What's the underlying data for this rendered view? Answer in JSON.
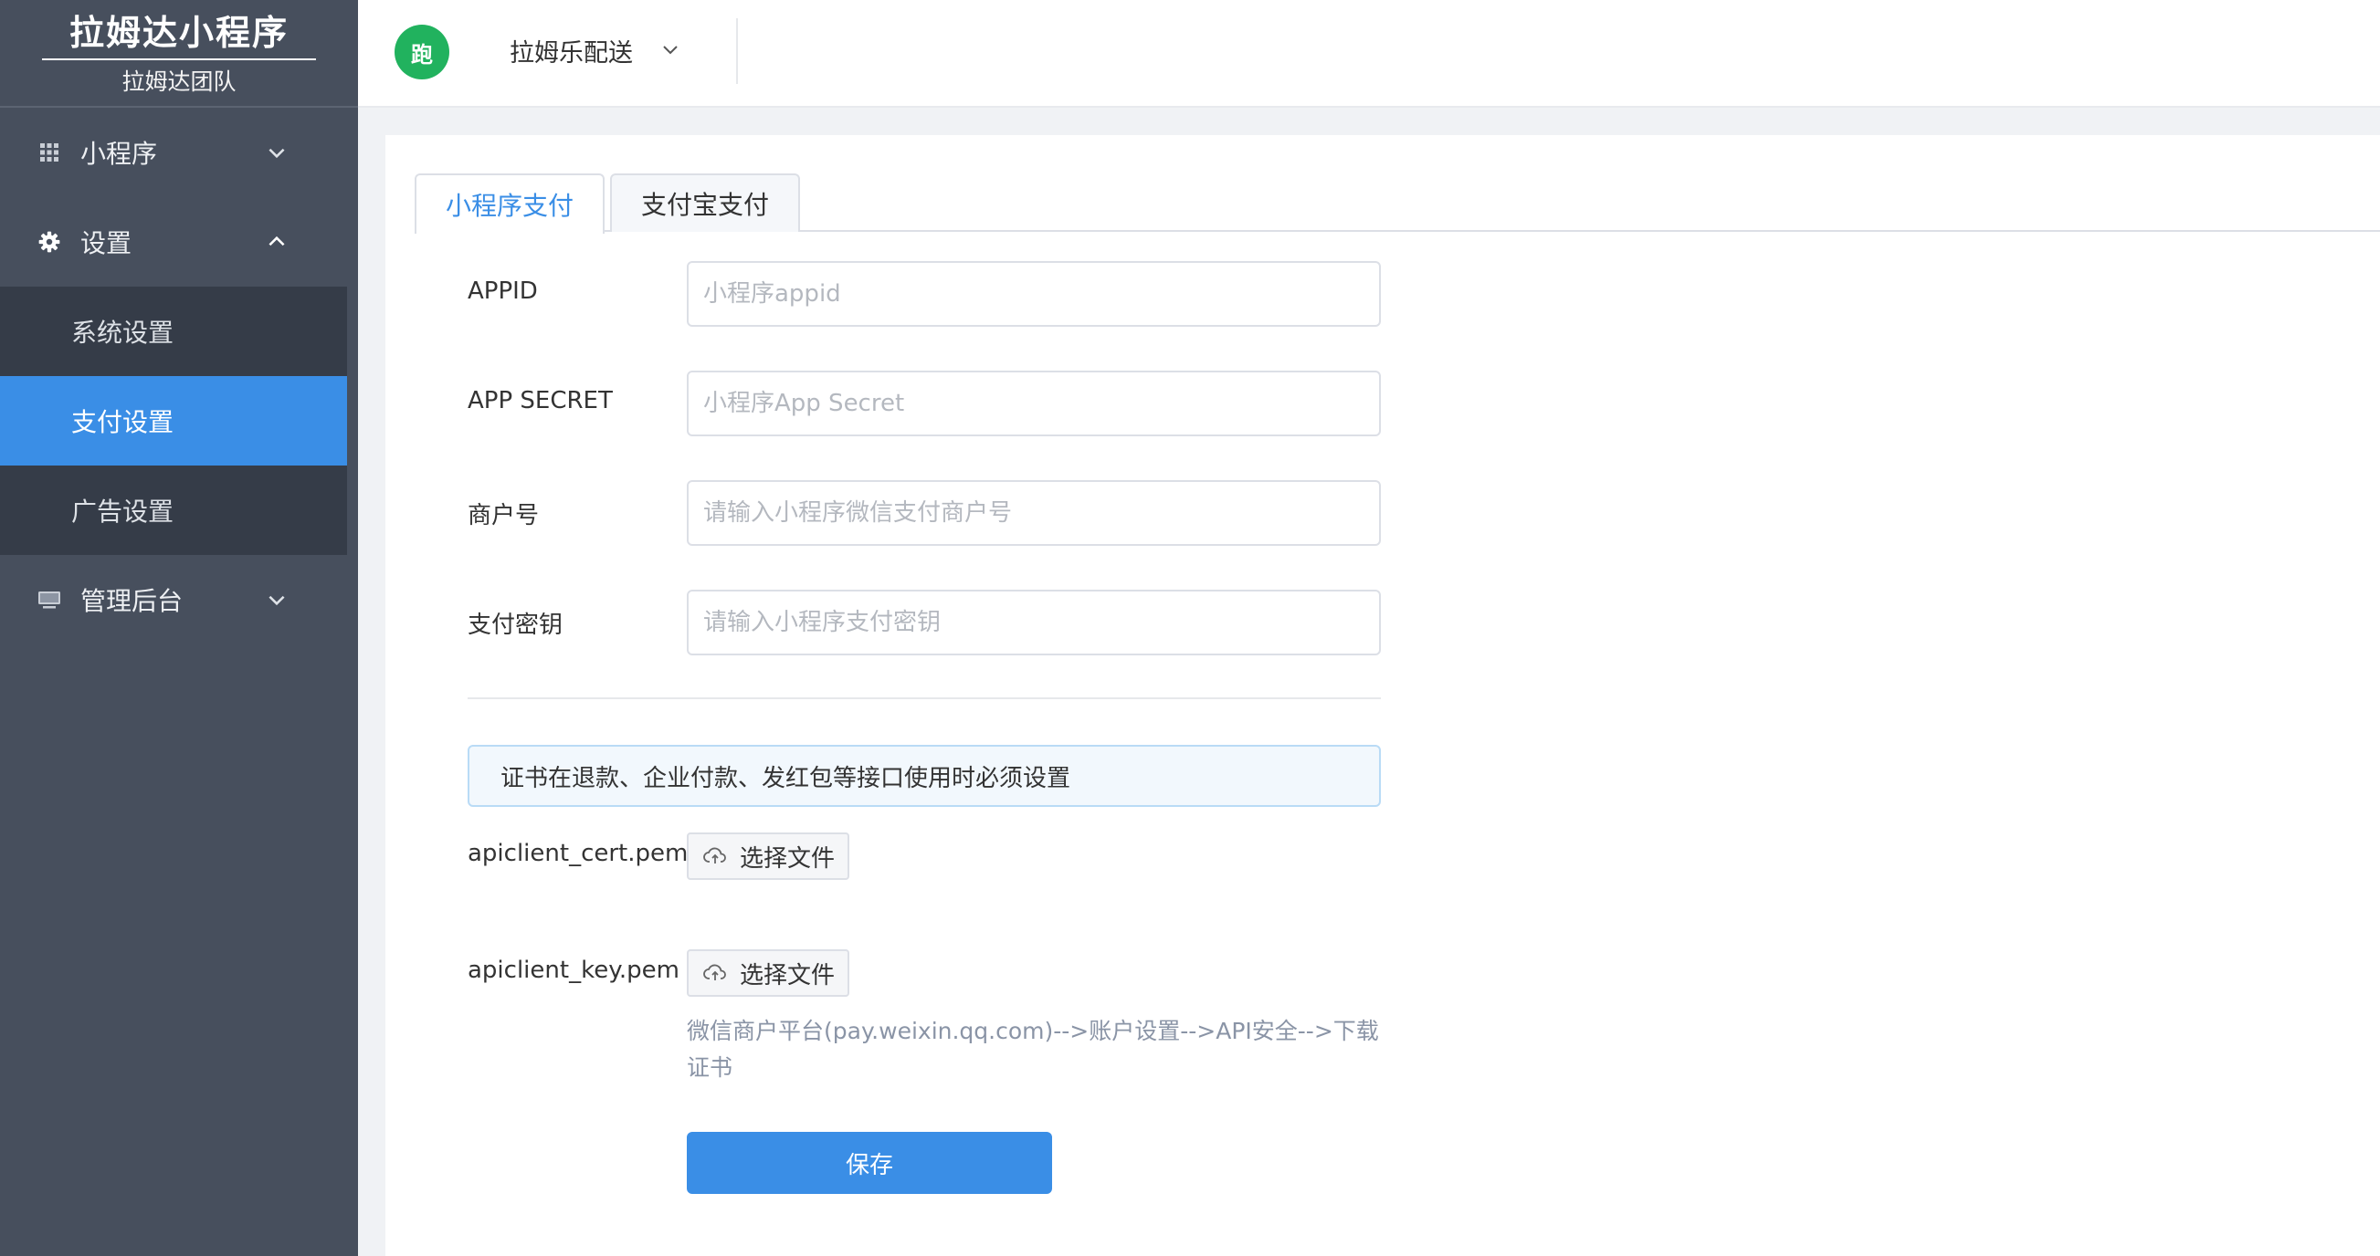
{
  "brand": {
    "title": "拉姆达小程序",
    "subtitle": "拉姆达团队"
  },
  "sidebar": {
    "menu": [
      {
        "label": "小程序",
        "icon": "grid-icon",
        "expanded": false
      },
      {
        "label": "设置",
        "icon": "gear-icon",
        "expanded": true
      },
      {
        "label": "管理后台",
        "icon": "monitor-icon",
        "expanded": false
      }
    ],
    "settings_sub": [
      {
        "label": "系统设置",
        "active": false
      },
      {
        "label": "支付设置",
        "active": true
      },
      {
        "label": "广告设置",
        "active": false
      }
    ]
  },
  "header": {
    "avatar_text": "跑",
    "store_name": "拉姆乐配送"
  },
  "tabs": [
    {
      "label": "小程序支付",
      "active": true
    },
    {
      "label": "支付宝支付",
      "active": false
    }
  ],
  "form": {
    "appid": {
      "label": "APPID",
      "placeholder": "小程序appid",
      "value": ""
    },
    "secret": {
      "label": "APP SECRET",
      "placeholder": "小程序App Secret",
      "value": ""
    },
    "mch_id": {
      "label": "商户号",
      "placeholder": "请输入小程序微信支付商户号",
      "value": ""
    },
    "pay_key": {
      "label": "支付密钥",
      "placeholder": "请输入小程序支付密钥",
      "value": ""
    },
    "notice": "证书在退款、企业付款、发红包等接口使用时必须设置",
    "cert": {
      "label": "apiclient_cert.pem",
      "button": "选择文件"
    },
    "key": {
      "label": "apiclient_key.pem",
      "button": "选择文件"
    },
    "hint": "微信商户平台(pay.weixin.qq.com)-->账户设置-->API安全-->下载证书",
    "save": "保存"
  },
  "colors": {
    "sidebar_bg": "#474f5d",
    "sub_bg": "#353c48",
    "accent": "#3a8ee6",
    "avatar": "#21b25e"
  }
}
